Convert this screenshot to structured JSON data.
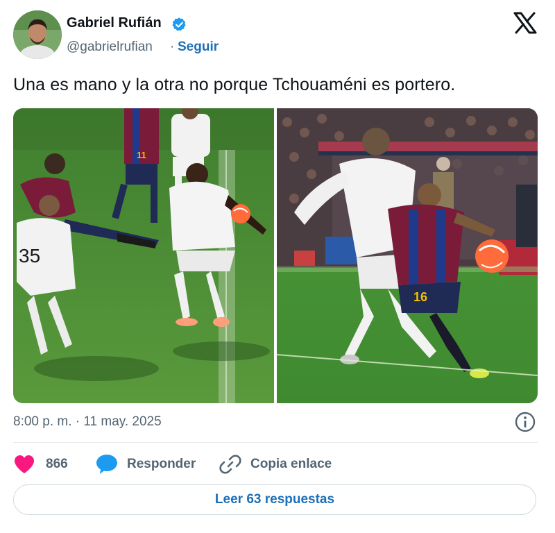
{
  "author": {
    "name": "Gabriel Rufián",
    "handle": "@gabrielrufian",
    "separator": "·",
    "follow_label": "Seguir",
    "verified": true
  },
  "tweet": {
    "text": "Una es mano y la otra no porque Tchouaméni es portero.",
    "timestamp": "8:00 p. m. · 11 may. 2025"
  },
  "media": {
    "left_image": {
      "jersey_number": "35",
      "jersey_number_2": "11"
    },
    "right_image": {
      "jersey_number": "16"
    }
  },
  "actions": {
    "like_count": "866",
    "reply_label": "Responder",
    "copy_label": "Copia enlace"
  },
  "read_replies_label": "Leer 63 respuestas",
  "colors": {
    "accent": "#1d6fb8",
    "like": "#f91880",
    "reply_bubble": "#1d9bf0",
    "secondary_text": "#536471",
    "pitch": "#4a8a35"
  },
  "icons": {
    "platform": "x-logo-icon",
    "verified": "verified-badge-icon",
    "info": "info-icon",
    "like": "heart-icon",
    "reply": "speech-bubble-icon",
    "copy": "link-icon"
  }
}
